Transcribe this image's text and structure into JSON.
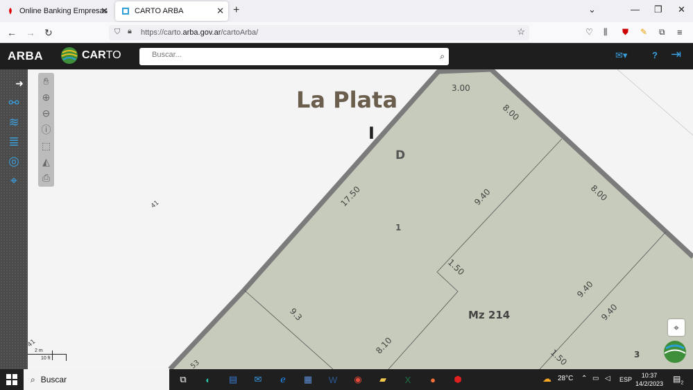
{
  "browser": {
    "tabs": [
      {
        "label": "Online Banking Empresas",
        "favicon": "santander-flame-icon"
      },
      {
        "label": "CARTO ARBA",
        "favicon": "carto-arba-icon"
      }
    ],
    "url": {
      "prefix": "https://carto.",
      "domain": "arba.gov.ar",
      "path": "/cartoArba/"
    }
  },
  "app": {
    "logo": "ARBA",
    "carto_label": "CAR",
    "carto_label_tail": "TO",
    "search": {
      "placeholder": "Buscar..."
    }
  },
  "map": {
    "city": "La Plata",
    "block_letter": "D",
    "block_letter_i": "I",
    "manzana": "Mz 214",
    "parcel_numbers": [
      "1",
      "3"
    ],
    "dimensions": [
      "3.00",
      "8.00",
      "17.50",
      "9.40",
      "8.00",
      "1.50",
      "9.40",
      "9.40",
      "9.3",
      "8.10",
      "1.50",
      "41",
      "41",
      "53"
    ],
    "scale": {
      "metric": "2 m",
      "imperial": "10 ft"
    },
    "colors": {
      "parcel": "#c7cbbb",
      "border": "#7b7b7b",
      "background": "#f4f4f5"
    }
  },
  "taskbar": {
    "search_label": "Buscar",
    "weather": "28°C",
    "language": "ESP",
    "time": "10:37",
    "date": "14/2/2023",
    "notifications": "2"
  }
}
